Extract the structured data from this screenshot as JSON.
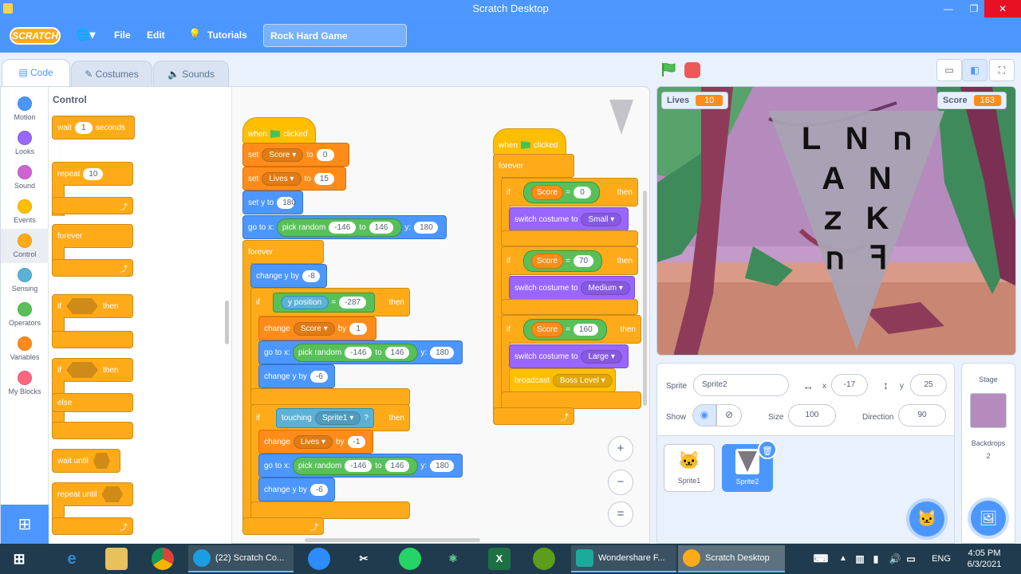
{
  "window": {
    "title": "Scratch Desktop",
    "minimize": "—",
    "restore": "❐",
    "close": "✕"
  },
  "menu": {
    "logo": "SCRATCH",
    "globe": "🌐▾",
    "file": "File",
    "edit": "Edit",
    "tutorials": "Tutorials",
    "project_title": "Rock Hard Game"
  },
  "tabs": {
    "code": "Code",
    "costumes": "Costumes",
    "sounds": "Sounds"
  },
  "categories": [
    {
      "label": "Motion",
      "color": "#4c97ff"
    },
    {
      "label": "Looks",
      "color": "#9966ff"
    },
    {
      "label": "Sound",
      "color": "#cf63cf"
    },
    {
      "label": "Events",
      "color": "#ffbf00"
    },
    {
      "label": "Control",
      "color": "#ffab19"
    },
    {
      "label": "Sensing",
      "color": "#5cb1d6"
    },
    {
      "label": "Operators",
      "color": "#59c059"
    },
    {
      "label": "Variables",
      "color": "#ff8c1a"
    },
    {
      "label": "My Blocks",
      "color": "#ff6680"
    }
  ],
  "palette": {
    "title": "Control",
    "wait": "wait",
    "wait_val": "1",
    "seconds": "seconds",
    "repeat": "repeat",
    "repeat_val": "10",
    "forever": "forever",
    "if": "if",
    "then": "then",
    "else": "else",
    "wait_until": "wait until",
    "repeat_until": "repeat until"
  },
  "script1": {
    "when": "when",
    "clicked": "clicked",
    "set": "set",
    "to": "to",
    "var_score": "Score",
    "score_val": "0",
    "var_lives": "Lives",
    "lives_val": "15",
    "set_y": "set y to",
    "set_y_val": "180",
    "go_to_x": "go to x:",
    "pick_random": "pick random",
    "rand_min": "-146",
    "rand_max": "146",
    "y_label": "y:",
    "go_y": "180",
    "forever": "forever",
    "change_y": "change y by",
    "change_y_val": "-8",
    "if": "if",
    "then": "then",
    "y_position": "y position",
    "eq": "=",
    "ypos_val": "-287",
    "change": "change",
    "by": "by",
    "change_score_val": "1",
    "change_y2_val": "-6",
    "touching": "touching",
    "sprite1": "Sprite1",
    "q": "?",
    "change_lives_val": "-1",
    "change_y3_val": "-6"
  },
  "script2": {
    "when": "when",
    "clicked": "clicked",
    "forever": "forever",
    "if": "if",
    "then": "then",
    "score": "Score",
    "eq": "=",
    "v1": "0",
    "v2": "70",
    "v3": "160",
    "switch_costume": "switch costume to",
    "c1": "Small",
    "c2": "Medium",
    "c3": "Large",
    "broadcast": "broadcast",
    "message": "Boss Level"
  },
  "zoom": {
    "in": "+",
    "out": "−",
    "reset": "="
  },
  "stage": {
    "lives_label": "Lives",
    "lives_val": "10",
    "score_label": "Score",
    "score_val": "163",
    "rune_lines": [
      "L N 𐌿",
      "A N",
      "𐌶 K",
      "𐌿 ꟻ"
    ]
  },
  "sprite_info": {
    "sprite_label": "Sprite",
    "sprite_name": "Sprite2",
    "x_label": "x",
    "x_val": "-17",
    "y_label": "y",
    "y_val": "25",
    "show_label": "Show",
    "size_label": "Size",
    "size_val": "100",
    "direction_label": "Direction",
    "direction_val": "90"
  },
  "sprites": [
    {
      "name": "Sprite1"
    },
    {
      "name": "Sprite2"
    }
  ],
  "stage_pane": {
    "title": "Stage",
    "backdrops_label": "Backdrops",
    "backdrops_count": "2"
  },
  "taskbar": {
    "task1": "(22) Scratch Co...",
    "task2": "Wondershare F...",
    "task3": "Scratch Desktop",
    "lang": "ENG",
    "time": "4:05 PM",
    "date": "6/3/2021"
  },
  "colors": {
    "accent": "#4c97ff",
    "control": "#ffab19",
    "variables": "#ff8c1a",
    "looks": "#9966ff",
    "motion": "#4c97ff",
    "operators": "#59c059",
    "sensing": "#5cb1d6",
    "events": "#ffbf00"
  }
}
